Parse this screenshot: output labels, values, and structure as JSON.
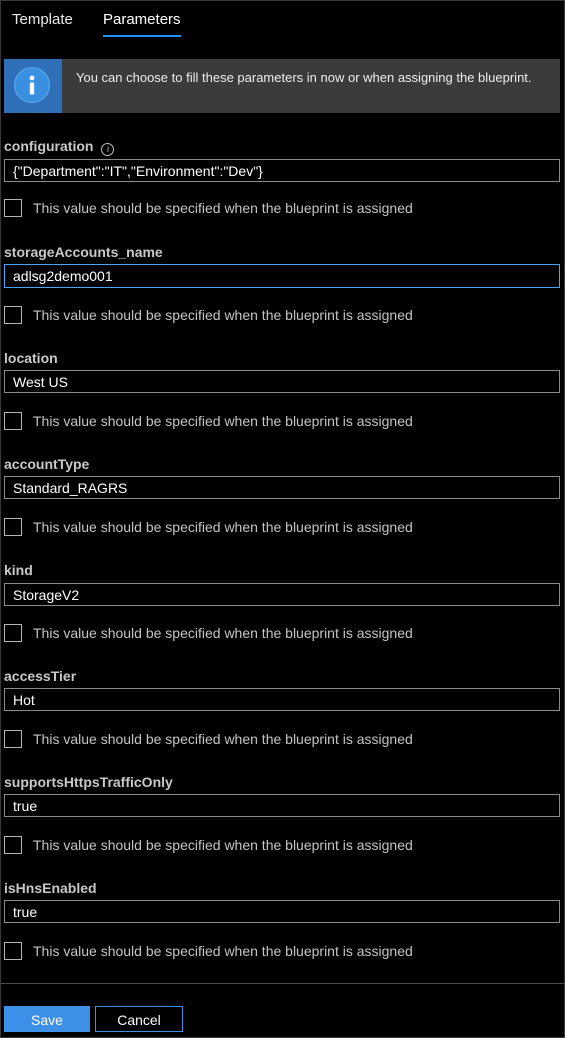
{
  "tabs": [
    {
      "label": "Template"
    },
    {
      "label": "Parameters"
    }
  ],
  "banner": {
    "text": "You can choose to fill these parameters in now or when assigning the blueprint."
  },
  "checkbox_label": "This value should be specified when the blueprint is assigned",
  "params": [
    {
      "label": "configuration",
      "value": "{\"Department\":\"IT\",\"Environment\":\"Dev\"}",
      "has_info": true
    },
    {
      "label": "storageAccounts_name",
      "value": "adlsg2demo001",
      "focused": true
    },
    {
      "label": "location",
      "value": "West US"
    },
    {
      "label": "accountType",
      "value": "Standard_RAGRS"
    },
    {
      "label": "kind",
      "value": "StorageV2"
    },
    {
      "label": "accessTier",
      "value": "Hot"
    },
    {
      "label": "supportsHttpsTrafficOnly",
      "value": "true"
    },
    {
      "label": "isHnsEnabled",
      "value": "true"
    }
  ],
  "buttons": {
    "save": "Save",
    "cancel": "Cancel"
  },
  "colors": {
    "accent": "#3d8fe8",
    "background": "#000000",
    "banner": "#3b3b3b"
  }
}
